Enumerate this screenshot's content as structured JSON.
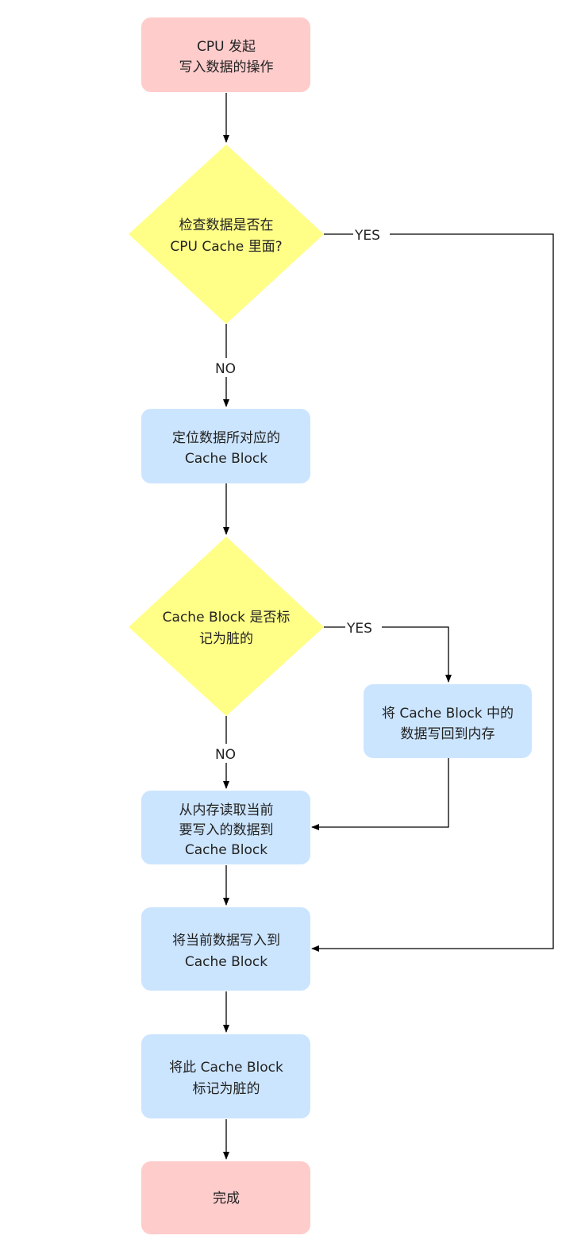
{
  "colors": {
    "start_end": "#ffcccc",
    "process": "#cce5ff",
    "decision": "#ffff88",
    "line": "#000000"
  },
  "nodes": {
    "start": {
      "line1": "CPU 发起",
      "line2": "写入数据的操作"
    },
    "check_cache": {
      "line1": "检查数据是否在",
      "line2": "CPU Cache 里面?"
    },
    "locate_block": {
      "line1": "定位数据所对应的",
      "line2": "Cache Block"
    },
    "check_dirty": {
      "line1": "Cache Block 是否标",
      "line2": "记为脏的"
    },
    "write_back": {
      "line1": "将 Cache Block 中的",
      "line2": "数据写回到内存"
    },
    "read_memory": {
      "line1": "从内存读取当前",
      "line2": "要写入的数据到",
      "line3": "Cache Block"
    },
    "write_data": {
      "line1": "将当前数据写入到",
      "line2": "Cache Block"
    },
    "mark_dirty": {
      "line1": "将此 Cache Block",
      "line2": "标记为脏的"
    },
    "done": {
      "line1": "完成"
    }
  },
  "edges": {
    "check_cache_yes": "YES",
    "check_cache_no": "NO",
    "check_dirty_yes": "YES",
    "check_dirty_no": "NO"
  }
}
